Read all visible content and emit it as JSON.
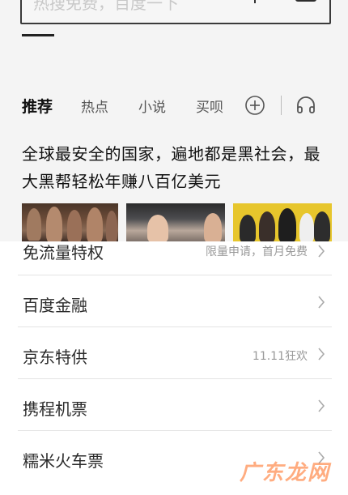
{
  "search": {
    "placeholder_text": "热搜免费，百度一下"
  },
  "tabs": [
    {
      "label": "推荐"
    },
    {
      "label": "热点"
    },
    {
      "label": "小说"
    },
    {
      "label": "买呗"
    }
  ],
  "feed": {
    "headline": "全球最安全的国家，遍地都是黑社会，最大黑帮轻松年赚八百亿美元"
  },
  "list": {
    "items": [
      {
        "label": "免流量特权",
        "note": "限量申请，首月免费"
      },
      {
        "label": "百度金融",
        "note": ""
      },
      {
        "label": "京东特供",
        "note": "11.11狂欢"
      },
      {
        "label": "携程机票",
        "note": ""
      },
      {
        "label": "糯米火车票",
        "note": ""
      }
    ]
  },
  "watermark": {
    "text": "广东龙网"
  },
  "colors": {
    "divider": "#e4e4e4",
    "watermark": "#ff6a1a",
    "tab_active": "#111111"
  }
}
